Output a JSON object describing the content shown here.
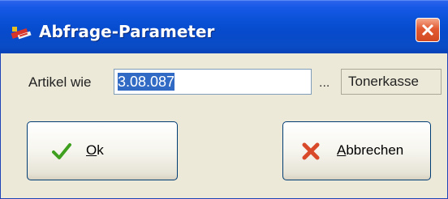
{
  "window": {
    "title": "Abfrage-Parameter",
    "app_icon": "app-logo-icon",
    "close_icon": "close-icon"
  },
  "form": {
    "label": "Artikel wie",
    "input_value": "3.08.087",
    "browse_label": "...",
    "lookup_value": "Tonerkasse"
  },
  "buttons": {
    "ok": {
      "mnemonic": "O",
      "rest": "k",
      "icon": "checkmark-icon"
    },
    "cancel": {
      "mnemonic": "A",
      "rest": "bbrechen",
      "icon": "cross-icon"
    }
  },
  "colors": {
    "title_bar": "#0a52d8",
    "close_button": "#e25a32",
    "selection": "#316ac5",
    "checkmark": "#3fa01f",
    "cross": "#d94a2a"
  }
}
